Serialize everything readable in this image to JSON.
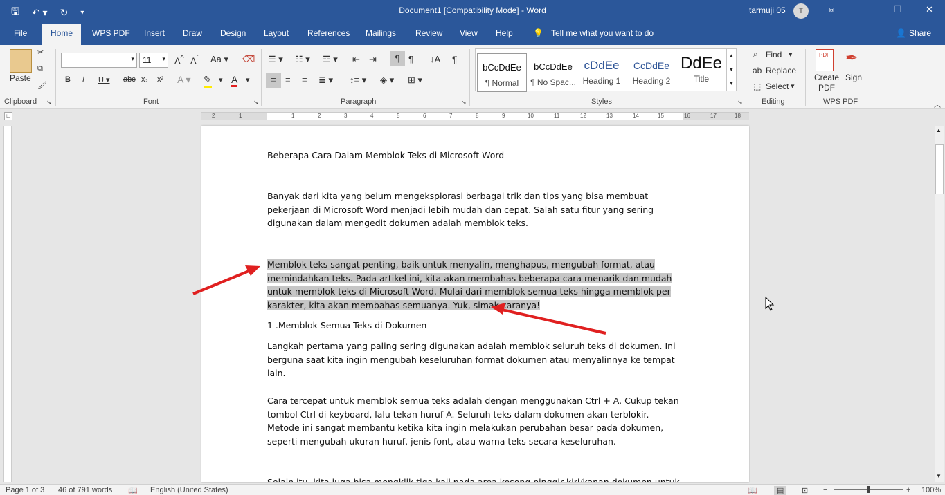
{
  "window": {
    "title": "Document1 [Compatibility Mode]  -  Word",
    "user": "tarmuji 05",
    "avatar_letter": "T"
  },
  "qat": {
    "save_icon": "save-icon",
    "undo_icon": "undo-icon",
    "redo_icon": "redo-icon",
    "customize_icon": "chevron-down-icon"
  },
  "menu": {
    "tabs": [
      "File",
      "Home",
      "WPS PDF",
      "Insert",
      "Draw",
      "Design",
      "Layout",
      "References",
      "Mailings",
      "Review",
      "View",
      "Help"
    ],
    "tell_me": "Tell me what you want to do",
    "share": "Share"
  },
  "ribbon": {
    "clipboard": {
      "paste": "Paste",
      "label": "Clipboard"
    },
    "font": {
      "font_name": "",
      "font_size": "11",
      "label": "Font"
    },
    "paragraph": {
      "label": "Paragraph"
    },
    "styles": {
      "label": "Styles",
      "items": [
        {
          "sample": "bCcDdEe",
          "name": "¶ Normal"
        },
        {
          "sample": "bCcDdEe",
          "name": "¶ No Spac..."
        },
        {
          "sample": "cDdEe",
          "name": "Heading 1"
        },
        {
          "sample": "CcDdEe",
          "name": "Heading 2"
        },
        {
          "sample": "DdEe",
          "name": "Title"
        }
      ]
    },
    "editing": {
      "find": "Find",
      "replace": "Replace",
      "select": "Select",
      "label": "Editing"
    },
    "wps": {
      "create_pdf": "Create PDF",
      "sign": "Sign",
      "label": "WPS PDF"
    }
  },
  "ruler": {
    "ticks": [
      "2",
      "1",
      "1",
      "2",
      "3",
      "4",
      "5",
      "6",
      "7",
      "8",
      "9",
      "10",
      "11",
      "12",
      "13",
      "14",
      "15",
      "16",
      "17",
      "18"
    ]
  },
  "document": {
    "title": "Beberapa Cara Dalam Memblok Teks di Microsoft Word",
    "para1": "Banyak dari kita yang belum mengeksplorasi berbagai trik dan tips yang bisa membuat pekerjaan di Microsoft Word menjadi lebih mudah dan cepat. Salah satu fitur yang sering digunakan dalam mengedit dokumen adalah memblok teks.",
    "para2": "Memblok teks sangat penting, baik untuk menyalin, menghapus, mengubah format, atau memindahkan teks. Pada artikel ini, kita akan membahas beberapa cara menarik dan mudah untuk memblok teks di Microsoft Word. Mulai dari memblok semua teks hingga memblok per karakter, kita akan membahas semuanya. Yuk, simak caranya!",
    "heading1": "1 .Memblok Semua Teks di Dokumen",
    "para3": "Langkah pertama yang paling sering digunakan adalah memblok seluruh teks di dokumen. Ini berguna saat kita ingin mengubah keseluruhan format dokumen atau menyalinnya ke tempat lain.",
    "para4": "Cara tercepat untuk memblok semua teks adalah dengan menggunakan Ctrl + A. Cukup tekan tombol Ctrl di keyboard, lalu tekan huruf A. Seluruh teks dalam dokumen akan terblokir. Metode ini sangat membantu ketika kita ingin melakukan perubahan besar pada dokumen, seperti mengubah ukuran huruf, jenis font, atau warna teks secara keseluruhan.",
    "para5": "Selain itu, kita juga bisa mengklik tiga kali pada area kosong pinggir kiri/kanan dokumen untuk"
  },
  "status": {
    "page": "Page 1 of 3",
    "words": "46 of 791 words",
    "language": "English (United States)",
    "zoom": "100%"
  },
  "colors": {
    "brand": "#2b579a",
    "highlight": "#c6c6c6",
    "arrow": "#e02020"
  }
}
